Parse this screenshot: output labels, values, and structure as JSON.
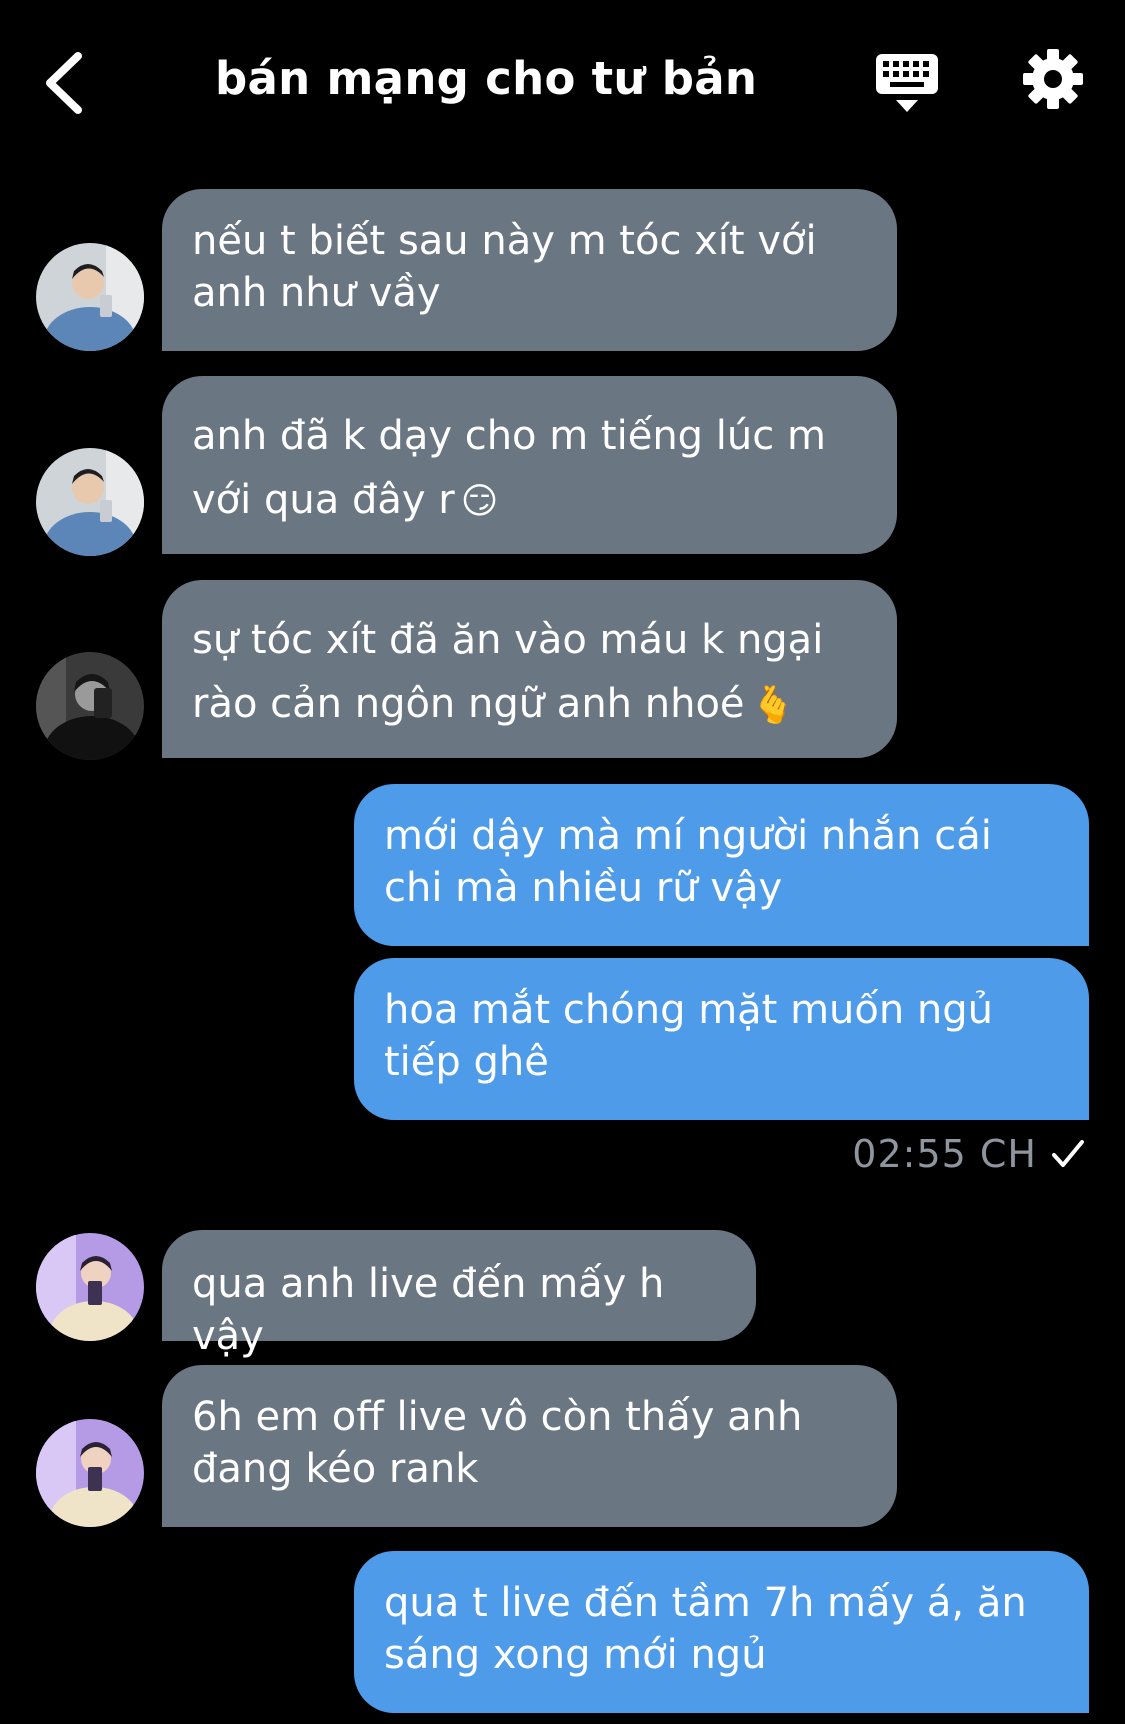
{
  "header": {
    "title": "bán mạng cho tư bản",
    "back_icon": "chevron-left-icon",
    "keyboard_icon": "keyboard-icon",
    "settings_icon": "gear-icon"
  },
  "messages": [
    {
      "direction": "in",
      "avatar": "avatar-blue-jacket",
      "text": "nếu t biết sau này m tóc xít với anh như vầy"
    },
    {
      "direction": "in",
      "avatar": "avatar-blue-jacket",
      "text": "anh đã k dạy cho m tiếng lúc m với qua đây r",
      "emoji": "😏"
    },
    {
      "direction": "in",
      "avatar": "avatar-black-jacket",
      "text": "sự tóc xít đã ăn vào máu k ngại rào cản ngôn ngữ anh nhoé",
      "emoji": "🫰"
    },
    {
      "direction": "out",
      "text": "mới dậy mà mí người nhắn cái chi mà nhiều rữ vậy"
    },
    {
      "direction": "out",
      "text": "hoa mắt chóng mặt muốn ngủ tiếp ghê"
    },
    {
      "direction": "in",
      "avatar": "avatar-purple",
      "text": "qua anh live đến mấy h vậy"
    },
    {
      "direction": "in",
      "avatar": "avatar-purple",
      "text": "6h em off live vô còn thấy anh đang kéo rank"
    },
    {
      "direction": "out",
      "text": "qua t live đến tầm 7h mấy á, ăn sáng xong mới ngủ"
    }
  ],
  "status": {
    "time": "02:55 CH",
    "read_icon": "checkmark-icon"
  },
  "colors": {
    "background": "#000000",
    "incoming_bubble": "#6b7683",
    "outgoing_bubble": "#4e9be9",
    "timestamp": "#8e959e"
  }
}
